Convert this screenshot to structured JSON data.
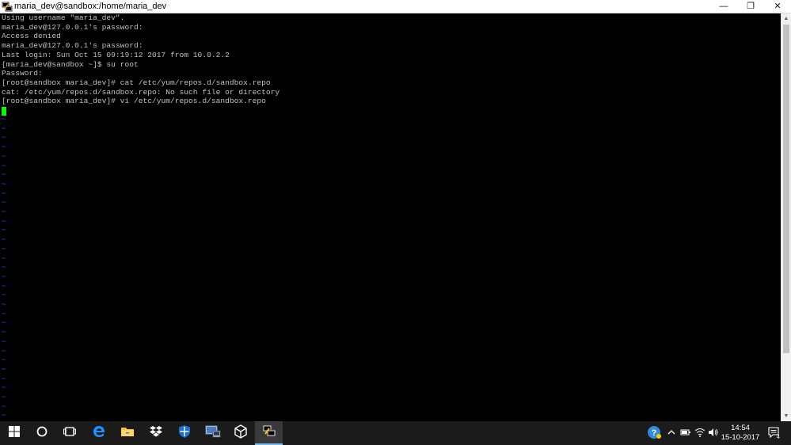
{
  "window": {
    "title": "maria_dev@sandbox:/home/maria_dev",
    "minimize_label": "—",
    "maximize_label": "❐",
    "close_label": "✕",
    "icon": "putty-icon"
  },
  "terminal": {
    "lines": [
      "Using username \"maria_dev\".",
      "maria_dev@127.0.0.1's password:",
      "Access denied",
      "maria_dev@127.0.0.1's password:",
      "Last login: Sun Oct 15 09:19:12 2017 from 10.0.2.2",
      "[maria_dev@sandbox ~]$ su root",
      "Password:",
      "[root@sandbox maria_dev]# cat /etc/yum/repos.d/sandbox.repo",
      "cat: /etc/yum/repos.d/sandbox.repo: No such file or directory",
      "[root@sandbox maria_dev]# vi /etc/yum/repos.d/sandbox.repo"
    ],
    "tilde_char": "~",
    "tilde_count": 33,
    "text_color": "#c0c0c0",
    "cursor_color": "#00ff00",
    "tilde_color": "#1e5bff"
  },
  "taskbar": {
    "apps": [
      {
        "name": "start",
        "icon": "windows-start-icon"
      },
      {
        "name": "cortana",
        "icon": "cortana-circle-icon"
      },
      {
        "name": "task-view",
        "icon": "task-view-icon"
      },
      {
        "name": "edge",
        "icon": "edge-browser-icon"
      },
      {
        "name": "file-explorer",
        "icon": "folder-icon"
      },
      {
        "name": "dropbox",
        "icon": "dropbox-icon"
      },
      {
        "name": "security",
        "icon": "shield-icon"
      },
      {
        "name": "remote-desktop",
        "icon": "remote-desktop-icon"
      },
      {
        "name": "virtualbox",
        "icon": "virtualbox-icon"
      },
      {
        "name": "putty",
        "icon": "putty-icon"
      }
    ],
    "tray": {
      "help_icon": "help-icon",
      "chevron_icon": "chevron-up-icon",
      "battery_icon": "battery-icon",
      "wifi_icon": "wifi-icon",
      "volume_icon": "volume-icon",
      "time": "14:54",
      "date": "15-10-2017",
      "notification_count": "4"
    }
  }
}
